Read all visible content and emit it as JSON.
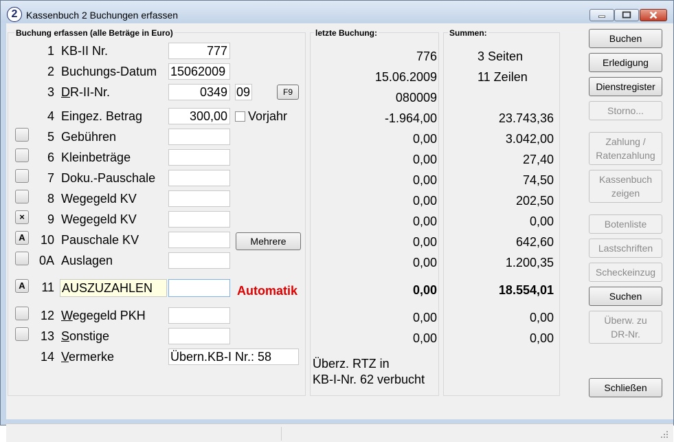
{
  "window": {
    "icon_glyph": "2",
    "title": "Kassenbuch 2 Buchungen erfassen"
  },
  "left_panel": {
    "title": "Buchung erfassen (alle Beträge in Euro)",
    "rows": [
      {
        "num": "1",
        "label": "KB-II Nr.",
        "value": "777"
      },
      {
        "num": "2",
        "label": "Buchungs-Datum",
        "value": "15062009"
      },
      {
        "num": "3",
        "label_u": "D",
        "label_rest": "R-II-Nr.",
        "value": "0349",
        "value2": "09",
        "button": "F9"
      },
      {
        "num": "4",
        "label": "Eingez. Betrag",
        "value": "300,00",
        "checkbox_label": "Vorjahr"
      },
      {
        "num": "5",
        "label": "Gebühren",
        "value": ""
      },
      {
        "num": "6",
        "label": "Kleinbeträge",
        "value": ""
      },
      {
        "num": "7",
        "label": "Doku.-Pauschale",
        "value": ""
      },
      {
        "num": "8",
        "label": "Wegegeld KV",
        "value": ""
      },
      {
        "num": "9",
        "label": "Wegegeld KV",
        "value": "",
        "check": "×"
      },
      {
        "num": "10",
        "label": "Pauschale KV",
        "value": "",
        "check": "A",
        "button": "Mehrere"
      },
      {
        "num": "0A",
        "label": "Auslagen",
        "value": ""
      },
      {
        "num": "11",
        "label": "AUSZUZAHLEN",
        "value": "",
        "check": "A",
        "note": "Automatik"
      },
      {
        "num": "12",
        "label_u": "W",
        "label_rest": "egegeld PKH",
        "value": ""
      },
      {
        "num": "13",
        "label_u": "S",
        "label_rest": "onstige",
        "value": ""
      },
      {
        "num": "14",
        "label_u": "V",
        "label_rest": "ermerke",
        "value": "Übern.KB-I Nr.: 58"
      }
    ]
  },
  "middle_panel": {
    "title": "letzte Buchung:",
    "values": [
      "776",
      "15.06.2009",
      "080009",
      "-1.964,00",
      "0,00",
      "0,00",
      "0,00",
      "0,00",
      "0,00",
      "0,00",
      "0,00",
      "0,00",
      "0,00",
      "0,00"
    ],
    "note_line1": "Überz. RTZ in",
    "note_line2": "KB-I-Nr. 62 verbucht"
  },
  "sums_panel": {
    "title": "Summen:",
    "pages": "3 Seiten",
    "lines": "11 Zeilen",
    "values": [
      "23.743,36",
      "3.042,00",
      "27,40",
      "74,50",
      "202,50",
      "0,00",
      "642,60",
      "1.200,35",
      "18.554,01",
      "0,00",
      "0,00"
    ]
  },
  "buttons": [
    {
      "label": "Buchen",
      "enabled": true
    },
    {
      "label": "Erledigung",
      "enabled": true
    },
    {
      "label": "Dienstregister",
      "enabled": true
    },
    {
      "label": "Storno...",
      "enabled": false
    },
    {
      "label": "Zahlung /\nRatenzahlung",
      "enabled": false
    },
    {
      "label": "Kassenbuch\nzeigen",
      "enabled": false
    },
    {
      "label": "Botenliste",
      "enabled": false
    },
    {
      "label": "Lastschriften",
      "enabled": false
    },
    {
      "label": "Scheckeinzug",
      "enabled": false
    },
    {
      "label": "Suchen",
      "enabled": true
    },
    {
      "label": "Überw. zu\nDR-Nr.",
      "enabled": false
    },
    {
      "label": "Schließen",
      "enabled": true
    }
  ],
  "colors": {
    "accent_red": "#e00000",
    "highlight_field": "#ffffe1",
    "focus_border": "#7eb4ea"
  }
}
